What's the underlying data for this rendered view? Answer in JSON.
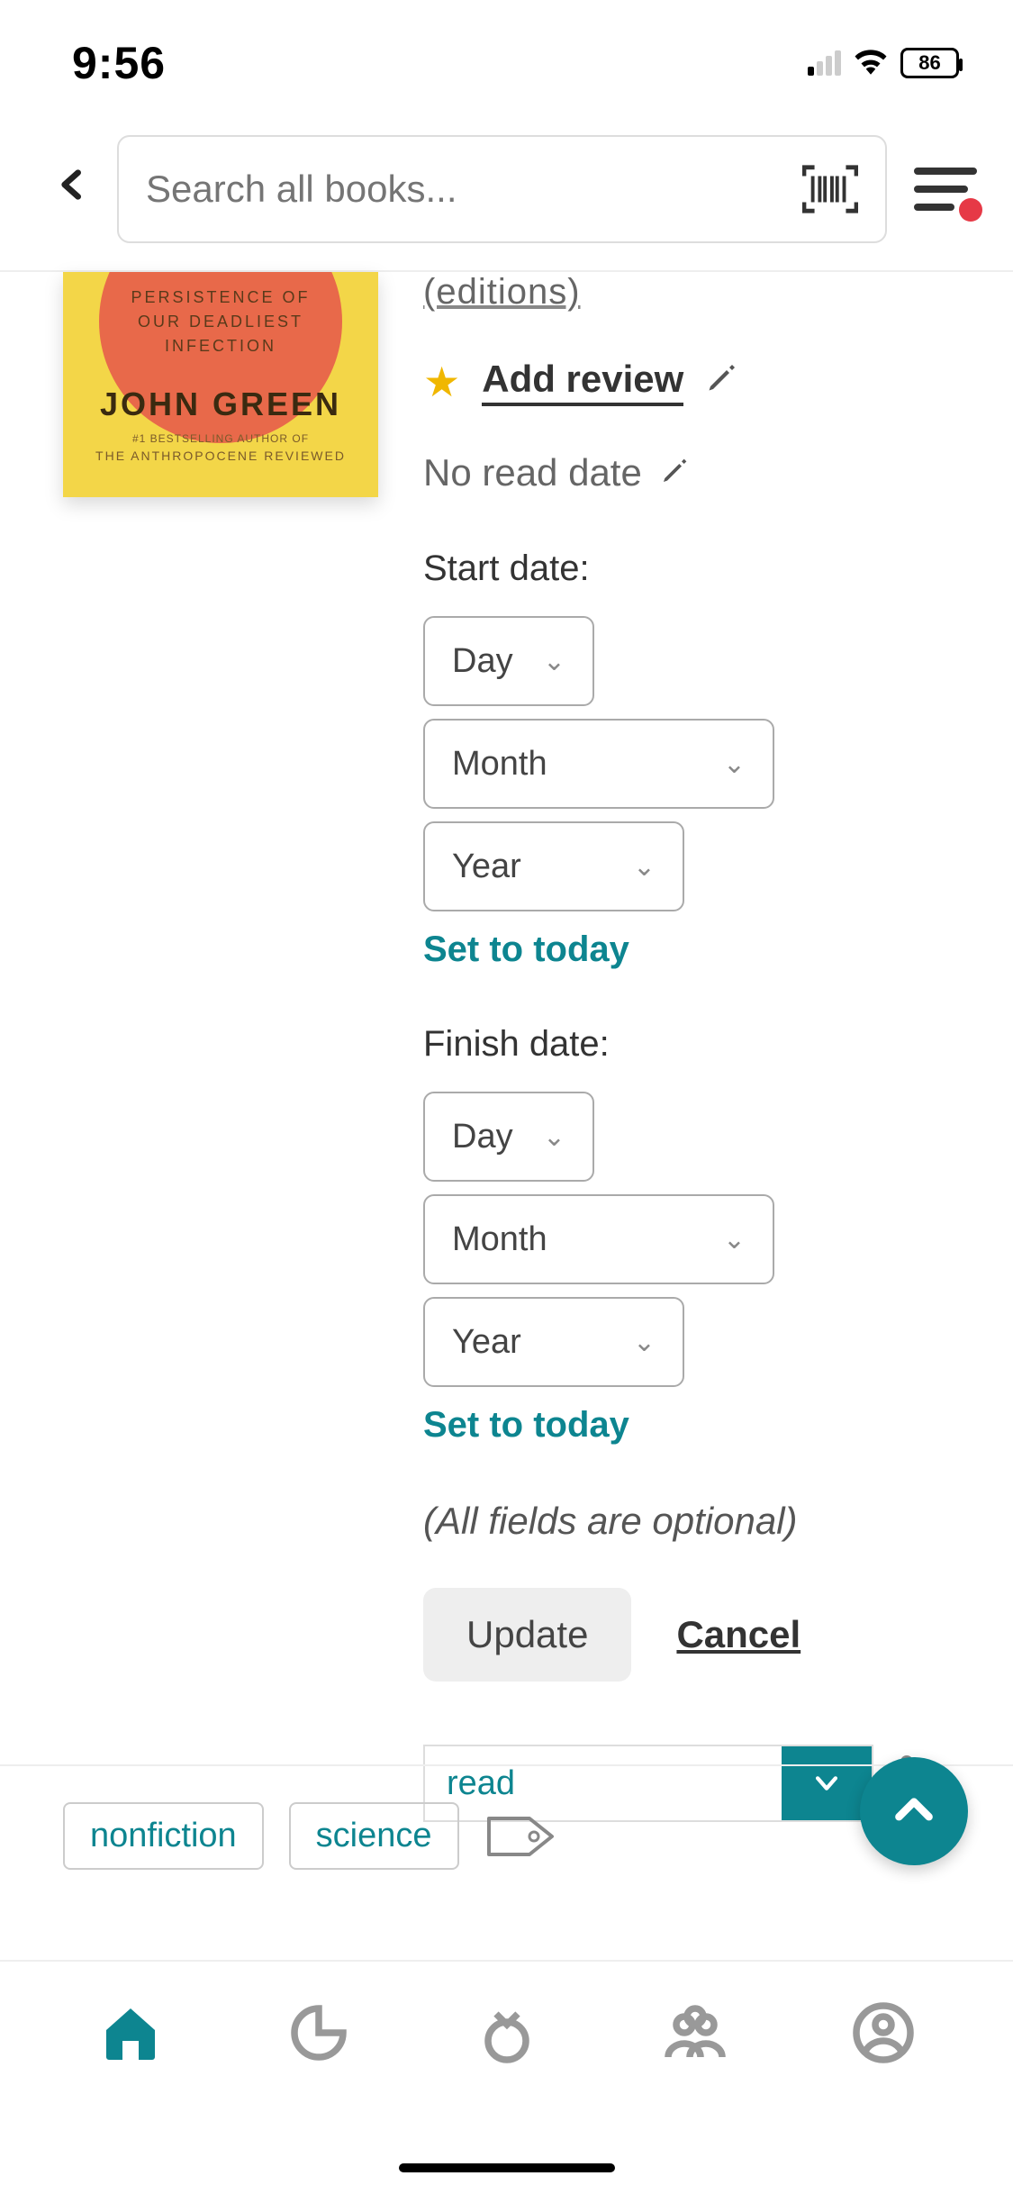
{
  "status": {
    "time": "9:56",
    "battery": "86"
  },
  "search": {
    "placeholder": "Search all books..."
  },
  "book": {
    "cover_sub1": "PERSISTENCE OF",
    "cover_sub2": "OUR DEADLIEST",
    "cover_sub3": "INFECTION",
    "author": "JOHN GREEN",
    "tag1": "#1 BESTSELLING AUTHOR OF",
    "tag2": "THE ANTHROPOCENE REVIEWED",
    "editions": "(editions)",
    "add_review": "Add review",
    "no_read_date": "No read date"
  },
  "start": {
    "label": "Start date:",
    "day": "Day",
    "month": "Month",
    "year": "Year",
    "set_today": "Set to today"
  },
  "finish": {
    "label": "Finish date:",
    "day": "Day",
    "month": "Month",
    "year": "Year",
    "set_today": "Set to today"
  },
  "optional_note": "(All fields are optional)",
  "actions": {
    "update": "Update",
    "cancel": "Cancel"
  },
  "status_select": {
    "value": "read"
  },
  "tags": {
    "nonfiction": "nonfiction",
    "science": "science"
  }
}
